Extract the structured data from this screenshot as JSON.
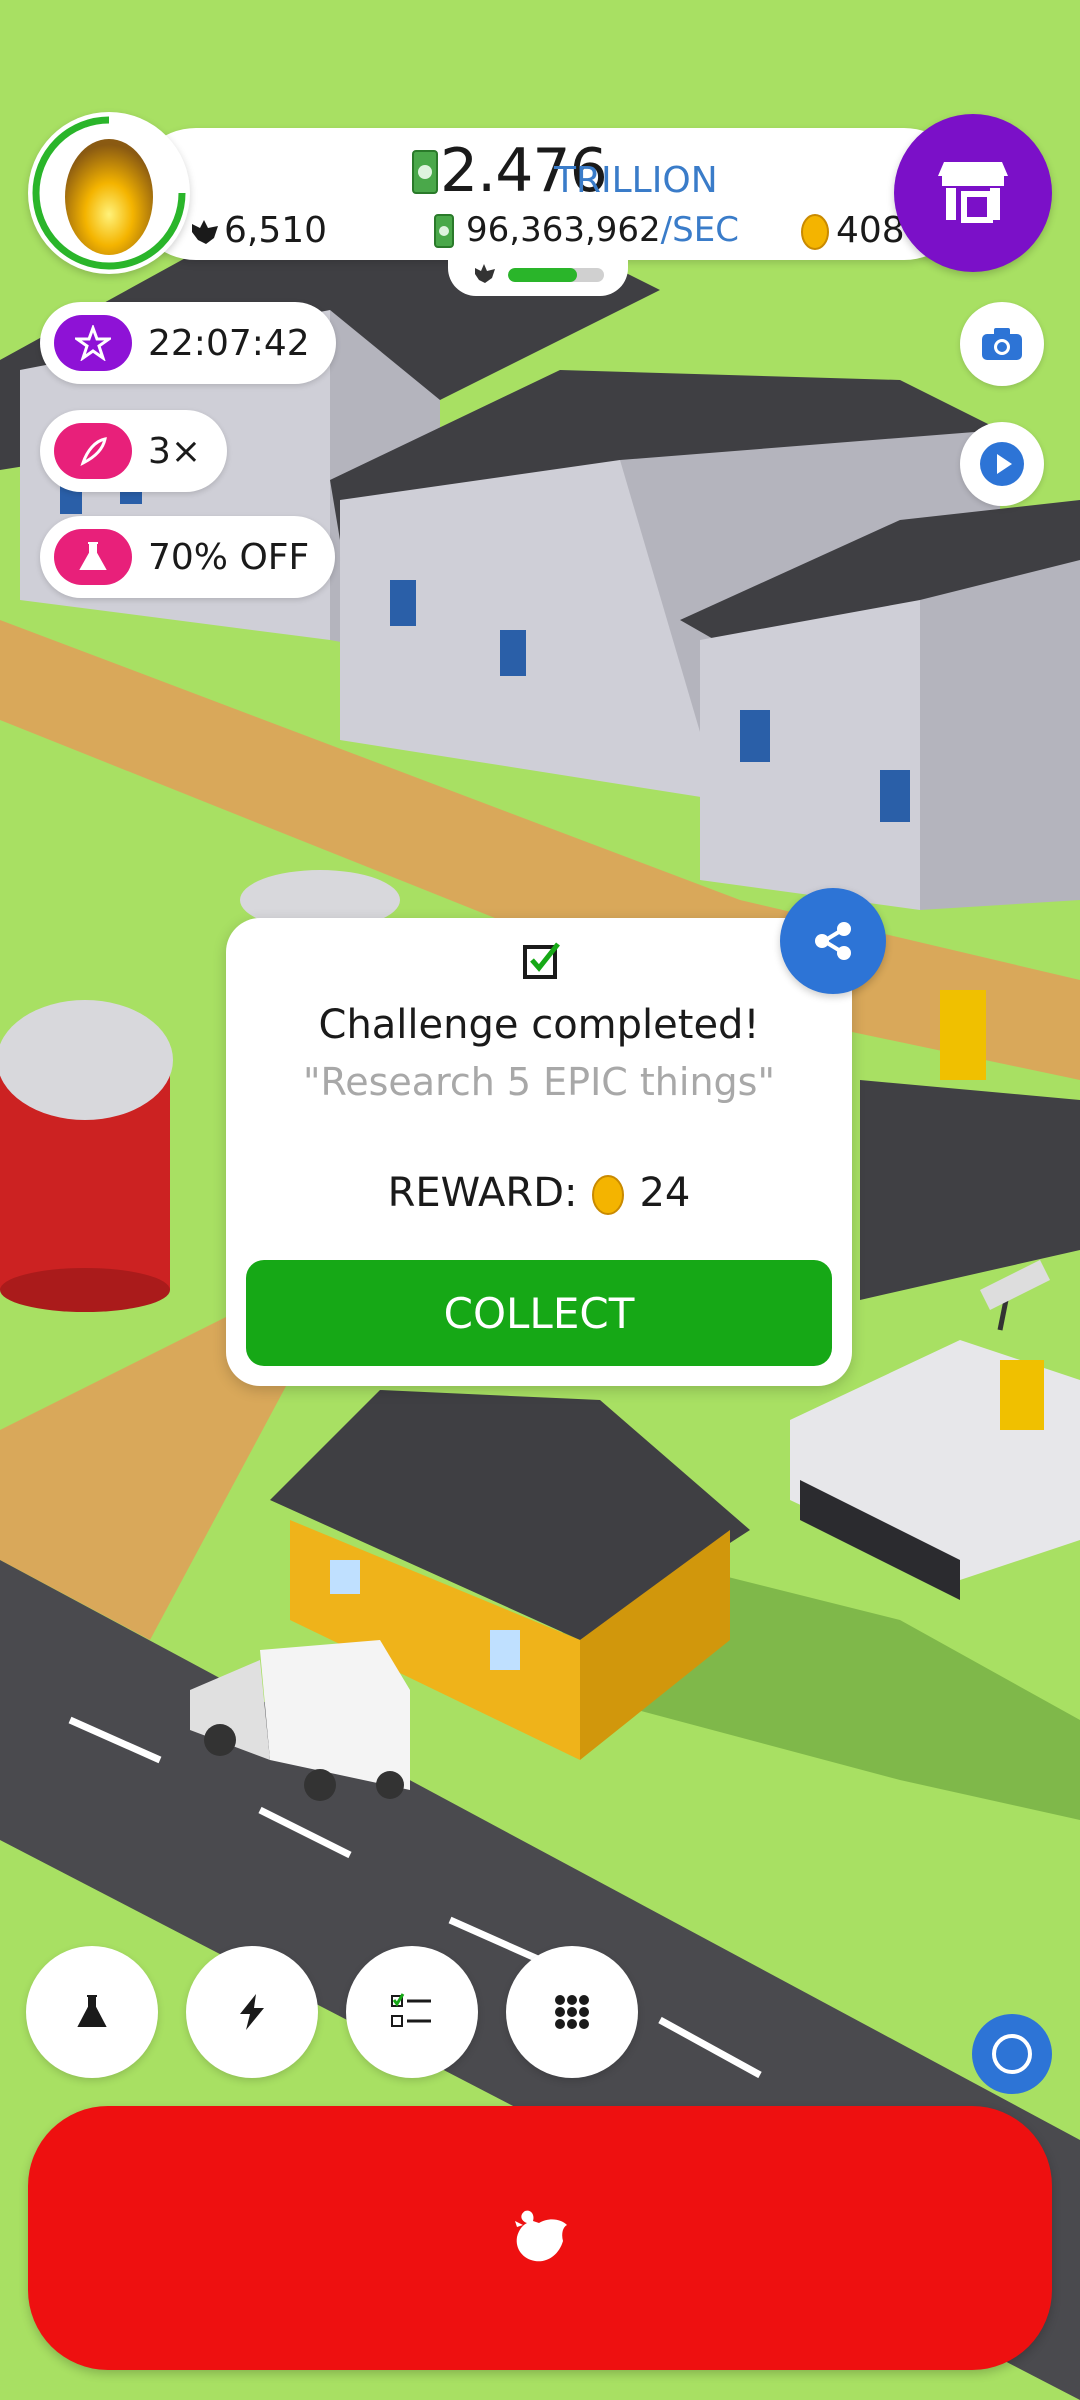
{
  "header": {
    "money_value": "2.476",
    "money_unit": "TRILLION",
    "rate_value": "96,363,962",
    "rate_unit": "/SEC",
    "chicken_count": "6,510",
    "golden_eggs": "408",
    "hab_progress": 0.72
  },
  "boosts": [
    {
      "label": "22:07:42",
      "icon": "star-icon",
      "color": "#8e12d6"
    },
    {
      "label": "3×",
      "icon": "feather-icon",
      "color": "#e8207a"
    },
    {
      "label": "70% OFF",
      "icon": "flask-icon",
      "color": "#e8207a"
    }
  ],
  "right_buttons": {
    "camera_icon": "camera-icon",
    "video_icon": "play-icon",
    "shop_icon": "shop-icon"
  },
  "dialog": {
    "title": "Challenge completed!",
    "subtitle": "\"Research 5 EPIC things\"",
    "reward_label": "REWARD:",
    "reward_amount": "24",
    "collect_label": "COLLECT"
  },
  "nav": [
    {
      "name": "research-button",
      "icon": "flask-icon"
    },
    {
      "name": "boost-button",
      "icon": "lightning-icon"
    },
    {
      "name": "challenges-button",
      "icon": "checklist-icon"
    },
    {
      "name": "menu-button",
      "icon": "grid-icon"
    }
  ],
  "colors": {
    "grass": "#a8e063",
    "hatch_button": "#ee1010",
    "collect_button": "#16a816",
    "shop_button": "#7b10c8",
    "accent_blue": "#2d74d6"
  }
}
